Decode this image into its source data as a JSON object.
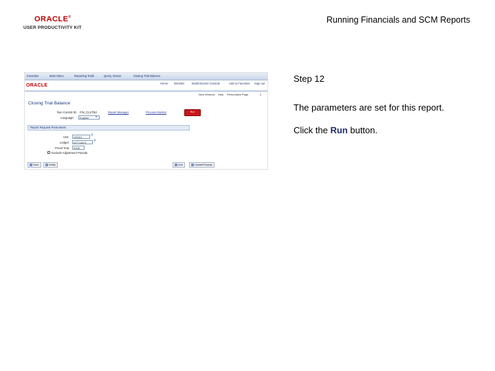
{
  "logo": {
    "brand": "ORACLE",
    "reg": "®",
    "product": "USER PRODUCTIVITY KIT"
  },
  "header": {
    "title": "Running Financials and SCM Reports"
  },
  "instructions": {
    "step": "Step 12",
    "line1": "The parameters are set for this report.",
    "line2_prefix": "Click the ",
    "line2_bold": "Run",
    "line2_suffix": " button."
  },
  "screenshot": {
    "nav": [
      "Favorites",
      "Main Menu",
      "Reporting Tools",
      "Query Viewer",
      "Closing Trial Balance"
    ],
    "brand": "ORACLE",
    "toplinks": [
      "Home",
      "Worklist",
      "MultiChannel Console",
      "Add to Favorites",
      "Sign out"
    ],
    "subtoplinks": [
      "New Window",
      "Help",
      "Personalize Page",
      "▯"
    ],
    "page_title": "Closing Trial Balance",
    "run_control_label": "Run Control ID:",
    "run_control_value": "FIN_CLSTB2",
    "report_manager": "Report Manager",
    "process_monitor": "Process Monitor",
    "run_button": "Run",
    "language_label": "Language:",
    "language_value": "English",
    "section_title": "Report Request Parameters",
    "unit_label": "Unit:",
    "unit_value": "US001",
    "ledger_label": "Ledger:",
    "ledger_value": "ACTUALS",
    "fiscal_year_label": "Fiscal Year:",
    "fiscal_year_value": "2005",
    "checkbox_label": "Exclude Adjustment Periods",
    "save_button": "Save",
    "notify_button": "Notify",
    "add_button": "Add",
    "update_display_button": "Update/Display"
  }
}
